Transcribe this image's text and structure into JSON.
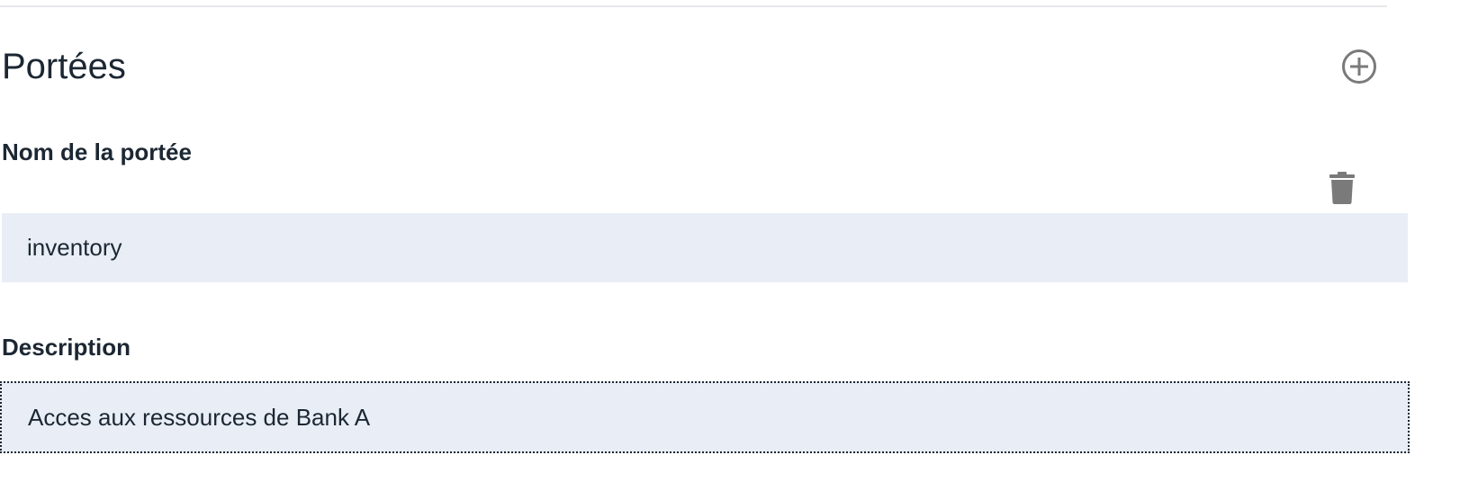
{
  "section": {
    "title": "Portées"
  },
  "icons": {
    "add": "plus-circle-icon",
    "delete": "trash-icon"
  },
  "scope_form": {
    "name_label": "Nom de la portée",
    "name_value": "inventory",
    "description_label": "Description",
    "description_value": "Acces aux ressources de Bank A"
  },
  "colors": {
    "text": "#1c2733",
    "icon": "#7a7a7a",
    "input_background": "#e9eef6",
    "divider": "#e6e8eb"
  }
}
